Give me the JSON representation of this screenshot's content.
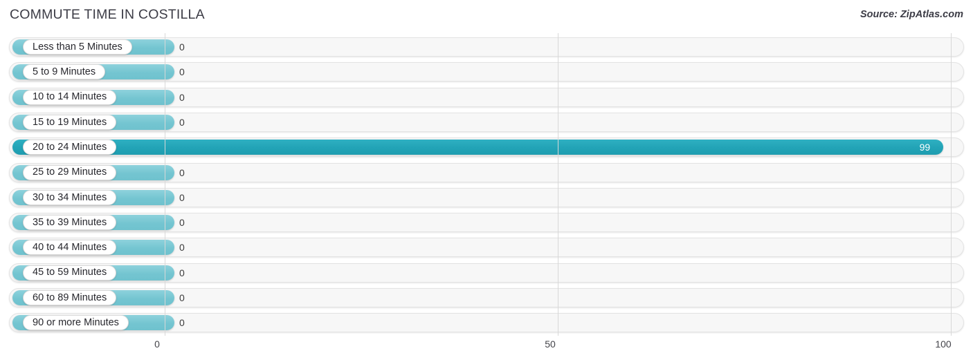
{
  "header": {
    "title": "COMMUTE TIME IN COSTILLA",
    "source": "Source: ZipAtlas.com"
  },
  "colors": {
    "bar_light": "#74c5d1",
    "bar_dark": "#22a3b6",
    "track": "#f7f7f7",
    "gridline": "#d8d8d8",
    "text": "#27272d"
  },
  "axis": {
    "ticks": [
      {
        "label": "0",
        "value": 0
      },
      {
        "label": "50",
        "value": 50
      },
      {
        "label": "100",
        "value": 100
      }
    ]
  },
  "chart_data": {
    "type": "bar",
    "orientation": "horizontal",
    "title": "COMMUTE TIME IN COSTILLA",
    "subtitle": "Source: ZipAtlas.com",
    "xlabel": "",
    "ylabel": "",
    "xlim": [
      0,
      100
    ],
    "grid": true,
    "legend": false,
    "categories": [
      "Less than 5 Minutes",
      "5 to 9 Minutes",
      "10 to 14 Minutes",
      "15 to 19 Minutes",
      "20 to 24 Minutes",
      "25 to 29 Minutes",
      "30 to 34 Minutes",
      "35 to 39 Minutes",
      "40 to 44 Minutes",
      "45 to 59 Minutes",
      "60 to 89 Minutes",
      "90 or more Minutes"
    ],
    "values": [
      0,
      0,
      0,
      0,
      99,
      0,
      0,
      0,
      0,
      0,
      0,
      0
    ],
    "value_labels": [
      "0",
      "0",
      "0",
      "0",
      "99",
      "0",
      "0",
      "0",
      "0",
      "0",
      "0",
      "0"
    ]
  },
  "rows": [
    {
      "label": "Less than 5 Minutes",
      "value": 0,
      "value_label": "0",
      "highlight": false
    },
    {
      "label": "5 to 9 Minutes",
      "value": 0,
      "value_label": "0",
      "highlight": false
    },
    {
      "label": "10 to 14 Minutes",
      "value": 0,
      "value_label": "0",
      "highlight": false
    },
    {
      "label": "15 to 19 Minutes",
      "value": 0,
      "value_label": "0",
      "highlight": false
    },
    {
      "label": "20 to 24 Minutes",
      "value": 99,
      "value_label": "99",
      "highlight": true
    },
    {
      "label": "25 to 29 Minutes",
      "value": 0,
      "value_label": "0",
      "highlight": false
    },
    {
      "label": "30 to 34 Minutes",
      "value": 0,
      "value_label": "0",
      "highlight": false
    },
    {
      "label": "35 to 39 Minutes",
      "value": 0,
      "value_label": "0",
      "highlight": false
    },
    {
      "label": "40 to 44 Minutes",
      "value": 0,
      "value_label": "0",
      "highlight": false
    },
    {
      "label": "45 to 59 Minutes",
      "value": 0,
      "value_label": "0",
      "highlight": false
    },
    {
      "label": "60 to 89 Minutes",
      "value": 0,
      "value_label": "0",
      "highlight": false
    },
    {
      "label": "90 or more Minutes",
      "value": 0,
      "value_label": "0",
      "highlight": false
    }
  ]
}
